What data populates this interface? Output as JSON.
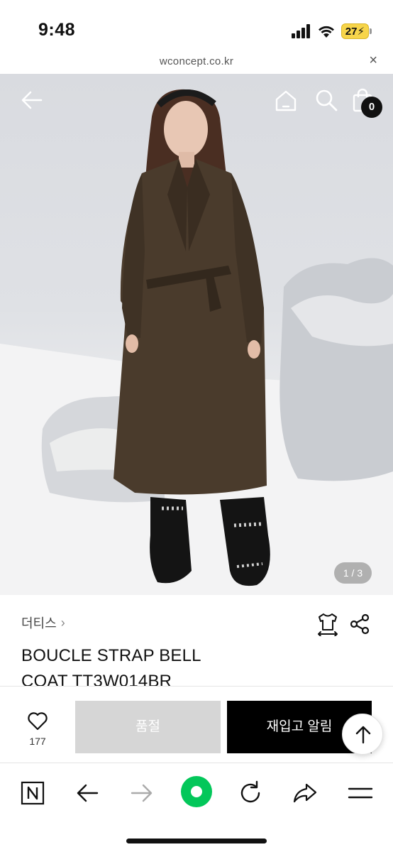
{
  "status_bar": {
    "time": "9:48",
    "battery": "27"
  },
  "browser": {
    "url": "wconcept.co.kr",
    "close_label": "×"
  },
  "header": {
    "cart_count": "0"
  },
  "gallery": {
    "page_indicator": "1 / 3"
  },
  "product": {
    "brand": "더티스",
    "brand_chevron": "›",
    "title_line1": "BOUCLE STRAP BELL",
    "title_line2": "COAT  TT3W014BR"
  },
  "actions": {
    "like_count": "177",
    "soldout_label": "품절",
    "restock_label": "재입고 알림"
  },
  "icons": {
    "back": "arrow-left-icon",
    "home": "home-icon",
    "search": "search-icon",
    "cart": "shopping-bag-icon",
    "size": "size-guide-icon",
    "share": "share-icon",
    "like": "heart-icon",
    "scroll_top": "arrow-up-icon"
  },
  "colors": {
    "accent_green": "#03c75a",
    "soldout_gray": "#d6d6d6",
    "primary_black": "#000000"
  }
}
